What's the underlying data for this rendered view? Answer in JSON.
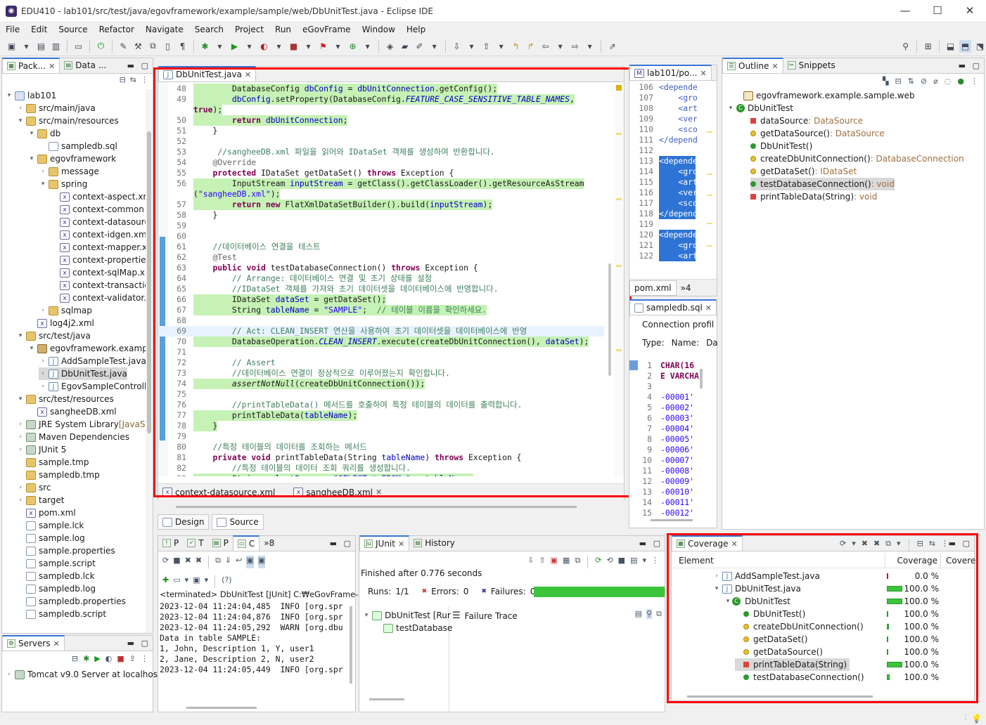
{
  "window": {
    "title": "EDU410 - lab101/src/test/java/egovframework/example/sample/web/DbUnitTest.java - Eclipse IDE",
    "minimize": "—",
    "maximize": "☐",
    "close": "✕"
  },
  "menu": [
    "File",
    "Edit",
    "Source",
    "Refactor",
    "Navigate",
    "Search",
    "Project",
    "Run",
    "eGovFrame",
    "Window",
    "Help"
  ],
  "left_panel": {
    "tabs": [
      "Pack...",
      "Data ..."
    ],
    "tree": [
      {
        "label": "lab101",
        "depth": 0,
        "tw": "▾",
        "icon": "proj"
      },
      {
        "label": "src/main/java",
        "depth": 1,
        "tw": "›",
        "icon": "src"
      },
      {
        "label": "src/main/resources",
        "depth": 1,
        "tw": "▾",
        "icon": "src"
      },
      {
        "label": "db",
        "depth": 2,
        "tw": "▾",
        "icon": "folder"
      },
      {
        "label": "sampledb.sql",
        "depth": 3,
        "tw": "",
        "icon": "file"
      },
      {
        "label": "egovframework",
        "depth": 2,
        "tw": "▾",
        "icon": "folder"
      },
      {
        "label": "message",
        "depth": 3,
        "tw": "›",
        "icon": "folder"
      },
      {
        "label": "spring",
        "depth": 3,
        "tw": "▾",
        "icon": "folder"
      },
      {
        "label": "context-aspect.xm",
        "depth": 4,
        "tw": "",
        "icon": "xml"
      },
      {
        "label": "context-common",
        "depth": 4,
        "tw": "",
        "icon": "xml"
      },
      {
        "label": "context-datasourc",
        "depth": 4,
        "tw": "",
        "icon": "xml"
      },
      {
        "label": "context-idgen.xm",
        "depth": 4,
        "tw": "",
        "icon": "xml"
      },
      {
        "label": "context-mapper.x",
        "depth": 4,
        "tw": "",
        "icon": "xml"
      },
      {
        "label": "context-propertie",
        "depth": 4,
        "tw": "",
        "icon": "xml"
      },
      {
        "label": "context-sqlMap.xi",
        "depth": 4,
        "tw": "",
        "icon": "xml"
      },
      {
        "label": "context-transactic",
        "depth": 4,
        "tw": "",
        "icon": "xml"
      },
      {
        "label": "context-validator.:",
        "depth": 4,
        "tw": "",
        "icon": "xml"
      },
      {
        "label": "sqlmap",
        "depth": 3,
        "tw": "›",
        "icon": "folder"
      },
      {
        "label": "log4j2.xml",
        "depth": 2,
        "tw": "",
        "icon": "xml"
      },
      {
        "label": "src/test/java",
        "depth": 1,
        "tw": "▾",
        "icon": "src"
      },
      {
        "label": "egovframework.example",
        "depth": 2,
        "tw": "▾",
        "icon": "lib"
      },
      {
        "label": "AddSampleTest.java",
        "depth": 3,
        "tw": "›",
        "icon": "java"
      },
      {
        "label": "DbUnitTest.java",
        "depth": 3,
        "tw": "›",
        "icon": "java",
        "selected": true
      },
      {
        "label": "EgovSampleControlle",
        "depth": 3,
        "tw": "›",
        "icon": "java"
      },
      {
        "label": "src/test/resources",
        "depth": 1,
        "tw": "▾",
        "icon": "src"
      },
      {
        "label": "sangheeDB.xml",
        "depth": 2,
        "tw": "",
        "icon": "xml"
      },
      {
        "label": "JRE System Library",
        "suffix": "[JavaSE",
        "depth": 1,
        "tw": "›",
        "icon": "jar"
      },
      {
        "label": "Maven Dependencies",
        "depth": 1,
        "tw": "›",
        "icon": "jar"
      },
      {
        "label": "JUnit 5",
        "depth": 1,
        "tw": "›",
        "icon": "jar"
      },
      {
        "label": "sample.tmp",
        "depth": 1,
        "tw": "",
        "icon": "folder"
      },
      {
        "label": "sampledb.tmp",
        "depth": 1,
        "tw": "",
        "icon": "folder"
      },
      {
        "label": "src",
        "depth": 1,
        "tw": "›",
        "icon": "folder"
      },
      {
        "label": "target",
        "depth": 1,
        "tw": "›",
        "icon": "folder"
      },
      {
        "label": "pom.xml",
        "depth": 1,
        "tw": "",
        "icon": "xml"
      },
      {
        "label": "sample.lck",
        "depth": 1,
        "tw": "",
        "icon": "file"
      },
      {
        "label": "sample.log",
        "depth": 1,
        "tw": "",
        "icon": "file"
      },
      {
        "label": "sample.properties",
        "depth": 1,
        "tw": "",
        "icon": "file"
      },
      {
        "label": "sample.script",
        "depth": 1,
        "tw": "",
        "icon": "file"
      },
      {
        "label": "sampledb.lck",
        "depth": 1,
        "tw": "",
        "icon": "file"
      },
      {
        "label": "sampledb.log",
        "depth": 1,
        "tw": "",
        "icon": "file"
      },
      {
        "label": "sampledb.properties",
        "depth": 1,
        "tw": "",
        "icon": "file"
      },
      {
        "label": "sampledb.script",
        "depth": 1,
        "tw": "",
        "icon": "file"
      }
    ]
  },
  "servers": {
    "tab": "Servers",
    "item": "Tomcat v9.0 Server at localhost"
  },
  "editor": {
    "tab": "DbUnitTest.java",
    "bottom_tabs": [
      "context-datasource.xml",
      "sangheeDB.xml"
    ],
    "design_tab": "Design",
    "source_tab": "Source",
    "lines": [
      {
        "n": "48",
        "hl": true,
        "html": "        DatabaseConfig <span class=\"fld\">dbConfig</span> = <span class=\"fld\">dbUnitConnection</span>.getConfig();"
      },
      {
        "n": "49",
        "hl": true,
        "html": "        <span class=\"fld\">dbConfig</span>.setProperty(DatabaseConfig.<span class=\"fld it\">FEATURE_CASE_SENSITIVE_TABLE_NAMES</span>,"
      },
      {
        "n": "",
        "hl": true,
        "wrap": true,
        "html": "<span class=\"kw\">true</span>);"
      },
      {
        "n": "50",
        "hl": true,
        "html": "        <span class=\"kw\">return</span> <span class=\"fld\">dbUnitConnection</span>;"
      },
      {
        "n": "51",
        "hl": false,
        "html": "    }"
      },
      {
        "n": "52",
        "hl": false,
        "html": ""
      },
      {
        "n": "53",
        "hl": false,
        "html": "     <span class=\"cm\">//sangheeDB.xml 파일을 읽어와 IDataSet 객체를 생성하여 반환합니다.</span>"
      },
      {
        "n": "54",
        "hl": false,
        "html": "    <span class=\"an\">@Override</span>"
      },
      {
        "n": "55",
        "hl": false,
        "html": "    <span class=\"kw\">protected</span> IDataSet getDataSet() <span class=\"kw\">throws</span> Exception {"
      },
      {
        "n": "56",
        "hl": true,
        "html": "        InputStream <span class=\"fld\">inputStream</span> = getClass().getClassLoader().getResourceAsStream"
      },
      {
        "n": "",
        "hl": true,
        "wrap": true,
        "html": "(<span class=\"st\">\"sangheeDB.xml\"</span>);"
      },
      {
        "n": "57",
        "hl": true,
        "html": "        <span class=\"kw\">return</span> <span class=\"kw\">new</span> FlatXmlDataSetBuilder().build(<span class=\"fld\">inputStream</span>);"
      },
      {
        "n": "58",
        "hl": false,
        "html": "    }"
      },
      {
        "n": "59",
        "hl": false,
        "html": ""
      },
      {
        "n": "60",
        "hl": false,
        "html": ""
      },
      {
        "n": "61",
        "hl": false,
        "html": "    <span class=\"cm\">//데이터베이스 연결을 테스트</span>"
      },
      {
        "n": "62",
        "hl": false,
        "html": "    <span class=\"an\">@Test</span>"
      },
      {
        "n": "63",
        "hl": false,
        "html": "    <span class=\"kw\">public</span> <span class=\"kw\">void</span> testDatabaseConnection() <span class=\"kw\">throws</span> Exception {"
      },
      {
        "n": "64",
        "hl": false,
        "html": "        <span class=\"cm\">// Arrange: 데이터베이스 연결 및 초기 상태를 설정</span>"
      },
      {
        "n": "65",
        "hl": false,
        "html": "        <span class=\"cm\">//IDataSet 객체를 가져와 초기 데이터셋을 데이터베이스에 반영합니다.</span>"
      },
      {
        "n": "66",
        "hl": true,
        "html": "        IDataSet <span class=\"fld\">dataSet</span> = getDataSet();"
      },
      {
        "n": "67",
        "hl": true,
        "html": "        String <span class=\"fld\">tableName</span> = <span class=\"st\">\"SAMPLE\"</span>;  <span class=\"cm\">// 테이블 이름을 확인하세요.</span>"
      },
      {
        "n": "68",
        "hl": false,
        "html": ""
      },
      {
        "n": "69",
        "hl": false,
        "cur": true,
        "html": "        <span class=\"cm\">// Act: CLEAN_INSERT 연산을 사용하여 초기 데이터셋을 데이터베이스에 반영</span>"
      },
      {
        "n": "70",
        "hl": true,
        "html": "        DatabaseOperation.<span class=\"fld it\">CLEAN_INSERT</span>.execute(createDbUnitConnection(), <span class=\"fld\">dataSet</span>);"
      },
      {
        "n": "71",
        "hl": false,
        "html": ""
      },
      {
        "n": "72",
        "hl": false,
        "html": "        <span class=\"cm\">// Assert</span>"
      },
      {
        "n": "73",
        "hl": false,
        "html": "        <span class=\"cm\">//데이터베이스 연결이 정상적으로 이루어졌는지 확인합니다.</span>"
      },
      {
        "n": "74",
        "hl": true,
        "html": "        <span class=\"it\">assertNotNull</span>(createDbUnitConnection());"
      },
      {
        "n": "75",
        "hl": false,
        "html": ""
      },
      {
        "n": "76",
        "hl": false,
        "html": "        <span class=\"cm\">//printTableData() 메서드를 호출하여 특정 테이블의 데이터를 출력합니다.</span>"
      },
      {
        "n": "77",
        "hl": true,
        "html": "        printTableData(<span class=\"fld\">tableName</span>);"
      },
      {
        "n": "78",
        "hl": true,
        "html": "    }"
      },
      {
        "n": "79",
        "hl": false,
        "html": ""
      },
      {
        "n": "80",
        "hl": false,
        "html": "    <span class=\"cm\">//특정 테이블의 데이터를 조회하는 메서드</span>"
      },
      {
        "n": "81",
        "hl": false,
        "html": "    <span class=\"kw\">private</span> <span class=\"kw\">void</span> printTableData(String <span class=\"fld\">tableName</span>) <span class=\"kw\">throws</span> Exception {"
      },
      {
        "n": "82",
        "hl": false,
        "html": "        <span class=\"cm\">//특정 테이블의 데이터 조회 쿼리를 생성합니다.</span>"
      },
      {
        "n": "83",
        "hl": true,
        "html": "        String <span class=\"fld\">selectQuery</span> = <span class=\"st\">\"SELECT * FROM \"</span> + <span class=\"fld\">tableName</span>;"
      }
    ]
  },
  "pom_panel": {
    "tab": "lab101/po...",
    "bottom_tabs": [
      "pom.xml",
      "»4"
    ],
    "lines": [
      {
        "n": "106",
        "t": "<depende",
        "sel": false
      },
      {
        "n": "107",
        "t": "    <gro",
        "sel": false
      },
      {
        "n": "108",
        "t": "    <art",
        "sel": false
      },
      {
        "n": "109",
        "t": "    <ver",
        "sel": false
      },
      {
        "n": "110",
        "t": "    <sco",
        "sel": false
      },
      {
        "n": "111",
        "t": "</depend",
        "sel": false
      },
      {
        "n": "112",
        "t": "",
        "sel": false
      },
      {
        "n": "113",
        "t": "<depende",
        "sel": true
      },
      {
        "n": "114",
        "t": "    <gro",
        "sel": true
      },
      {
        "n": "115",
        "t": "    <art",
        "sel": true
      },
      {
        "n": "116",
        "t": "    <ver",
        "sel": true
      },
      {
        "n": "117",
        "t": "    <sco",
        "sel": true
      },
      {
        "n": "118",
        "t": "</depend",
        "sel": true
      },
      {
        "n": "119",
        "t": "",
        "sel": false
      },
      {
        "n": "120",
        "t": "<depende",
        "sel": true
      },
      {
        "n": "121",
        "t": "    <gro",
        "sel": true
      },
      {
        "n": "122",
        "t": "    <art",
        "sel": true
      }
    ]
  },
  "sql_panel": {
    "tab": "sampledb.sql",
    "conn": "Connection profil",
    "type_label": "Type:",
    "name_label": "Name:",
    "da": "Da",
    "lines": [
      {
        "n": "1",
        "t": "CHAR(16"
      },
      {
        "n": "2",
        "t": "E VARCHA"
      },
      {
        "n": "3",
        "t": ""
      },
      {
        "n": "4",
        "t": "-00001'"
      },
      {
        "n": "5",
        "t": "-00002'"
      },
      {
        "n": "6",
        "t": "-00003'"
      },
      {
        "n": "7",
        "t": "-00004'"
      },
      {
        "n": "8",
        "t": "-00005'"
      },
      {
        "n": "9",
        "t": "-00006'"
      },
      {
        "n": "10",
        "t": "-00007'"
      },
      {
        "n": "11",
        "t": "-00008'"
      },
      {
        "n": "12",
        "t": "-00009'"
      },
      {
        "n": "13",
        "t": "-00010'"
      },
      {
        "n": "14",
        "t": "-00011'"
      },
      {
        "n": "15",
        "t": "-00012'"
      }
    ]
  },
  "outline": {
    "tabs": [
      "Outline",
      "Snippets"
    ],
    "package": "egovframework.example.sample.web",
    "class": "DbUnitTest",
    "items": [
      {
        "name": "dataSource",
        "type": " : DataSource",
        "icon": "sq-red"
      },
      {
        "name": "getDataSource()",
        "type": " : DataSource",
        "icon": "dot-yellow"
      },
      {
        "name": "DbUnitTest()",
        "type": "",
        "icon": "dot-green"
      },
      {
        "name": "createDbUnitConnection()",
        "type": " : DatabaseConnection",
        "icon": "dot-yellow"
      },
      {
        "name": "getDataSet()",
        "type": " : IDataSet",
        "icon": "dot-yellow"
      },
      {
        "name": "testDatabaseConnection()",
        "type": " : void",
        "icon": "dot-green",
        "selected": true
      },
      {
        "name": "printTableData(String)",
        "type": " : void",
        "icon": "sq-red"
      }
    ]
  },
  "console": {
    "tabs": [
      "P",
      "T",
      "P",
      "C",
      "»8"
    ],
    "header": "<terminated> DbUnitTest [JUnit] C:₩eGovFrame-4.1",
    "lines": [
      "2023-12-04 11:24:04,485  INFO [org.spr",
      "2023-12-04 11:24:04,876  INFO [org.spr",
      "2023-12-04 11:24:05,292  WARN [org.dbu",
      "Data in table SAMPLE:",
      "1, John, Description 1, Y, user1",
      "2, Jane, Description 2, N, user2",
      "2023-12-04 11:24:05,449  INFO [org.spr"
    ],
    "zoom_label": "(?)"
  },
  "junit": {
    "tabs": [
      "JUnit",
      "History"
    ],
    "finished": "Finished after 0.776 seconds",
    "runs_label": "Runs:",
    "runs": "1/1",
    "errors_label": "Errors:",
    "errors": "0",
    "failures_label": "Failures:",
    "failures": "0",
    "progress": 1.0,
    "tree": [
      "DbUnitTest [Rur",
      "testDatabase"
    ],
    "failure_trace": "Failure Trace"
  },
  "coverage": {
    "tab": "Coverage",
    "col_element": "Element",
    "col_coverage": "Coverage",
    "col_covered": "Covere",
    "rows": [
      {
        "label": "AddSampleTest.java",
        "depth": 0,
        "tw": "›",
        "icon": "java",
        "pct": "0.0 %",
        "bar": 0.02
      },
      {
        "label": "DbUnitTest.java",
        "depth": 0,
        "tw": "▾",
        "icon": "java",
        "pct": "100.0 %",
        "bar": 1.0
      },
      {
        "label": "DbUnitTest",
        "depth": 1,
        "tw": "▾",
        "icon": "class",
        "pct": "100.0 %",
        "bar": 1.0
      },
      {
        "label": "DbUnitTest()",
        "depth": 2,
        "tw": "",
        "icon": "dot-green",
        "pct": "100.0 %",
        "bar": 0.05
      },
      {
        "label": "createDbUnitConnection()",
        "depth": 2,
        "tw": "",
        "icon": "dot-yellow",
        "pct": "100.0 %",
        "bar": 0.15
      },
      {
        "label": "getDataSet()",
        "depth": 2,
        "tw": "",
        "icon": "dot-yellow",
        "pct": "100.0 %",
        "bar": 0.08
      },
      {
        "label": "getDataSource()",
        "depth": 2,
        "tw": "",
        "icon": "dot-yellow",
        "pct": "100.0 %",
        "bar": 0.05
      },
      {
        "label": "printTableData(String)",
        "depth": 2,
        "tw": "",
        "icon": "sq-red",
        "pct": "100.0 %",
        "bar": 1.0,
        "selected": true
      },
      {
        "label": "testDatabaseConnection()",
        "depth": 2,
        "tw": "",
        "icon": "dot-green",
        "pct": "100.0 %",
        "bar": 0.2
      }
    ]
  },
  "colors": {
    "highlight": "#c6f2b5",
    "selection": "#2e74d5",
    "redbox": "#ff0000",
    "coverage_bar": "#3cc43c"
  }
}
